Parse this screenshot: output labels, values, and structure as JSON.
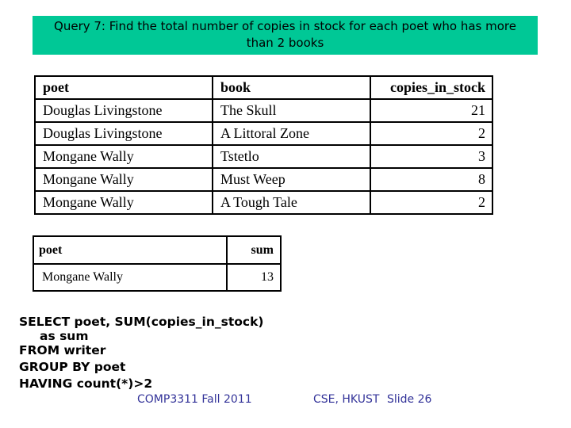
{
  "title": {
    "line1": "Query 7: Find the total number of copies in stock for each poet who has more",
    "line2": "than 2 books",
    "background": "#00c896"
  },
  "main_table": {
    "headers": [
      "poet",
      "book",
      "copies_in_stock"
    ],
    "rows": [
      [
        "Douglas Livingstone",
        "The Skull",
        "21"
      ],
      [
        "Douglas Livingstone",
        "A Littoral Zone",
        "2"
      ],
      [
        "Mongane Wally",
        "Tstetlo",
        "3"
      ],
      [
        "Mongane Wally",
        "Must Weep",
        "8"
      ],
      [
        "Mongane Wally",
        "A Tough Tale",
        "2"
      ]
    ]
  },
  "result_table": {
    "headers": [
      "poet",
      "sum"
    ],
    "rows": [
      [
        "Mongane Wally",
        "13"
      ]
    ]
  },
  "sql": {
    "lines": [
      "SELECT poet, SUM(copies_in_stock)",
      "as sum",
      "FROM writer",
      "GROUP BY poet",
      "HAVING count(*)>2"
    ]
  },
  "footer": {
    "course": "COMP3311 Fall 2011",
    "org": "CSE, HKUST",
    "slide": "Slide 26",
    "color": "#333399"
  }
}
